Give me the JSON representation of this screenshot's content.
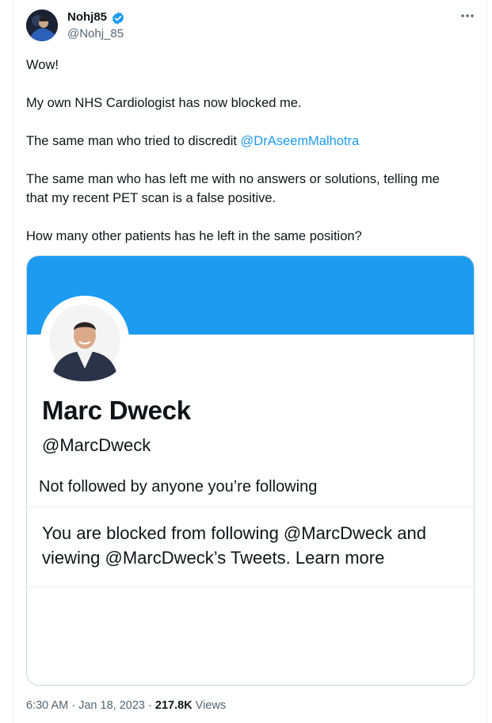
{
  "tweet": {
    "author_name": "Nohj85",
    "author_handle": "@Nohj_85",
    "verified": true,
    "accent_color": "#1d9bf0",
    "text_lines": [
      "Wow!",
      "My own NHS Cardiologist has now blocked me.",
      "The same man who tried to discredit ",
      "The same man who has left me with no answers or solutions, telling me",
      "that my recent PET scan is a false positive.",
      "How many other patients has he left in the same position?"
    ],
    "mention": "@DrAseemMalhotra",
    "time": "6:30 AM",
    "separator": "·",
    "date": "Jan 18, 2023",
    "views_count": "217.8K",
    "views_label": "Views"
  },
  "embedded_screenshot": {
    "banner_color": "#1d9bf0",
    "name": "Marc Dweck",
    "handle": "@MarcDweck",
    "followed_note": "Not followed by anyone you’re following",
    "blocked_line1": "You are blocked from following @MarcDweck and",
    "blocked_line2_prefix": "viewing @MarcDweck’s Tweets. ",
    "learn_more": "Learn more"
  }
}
